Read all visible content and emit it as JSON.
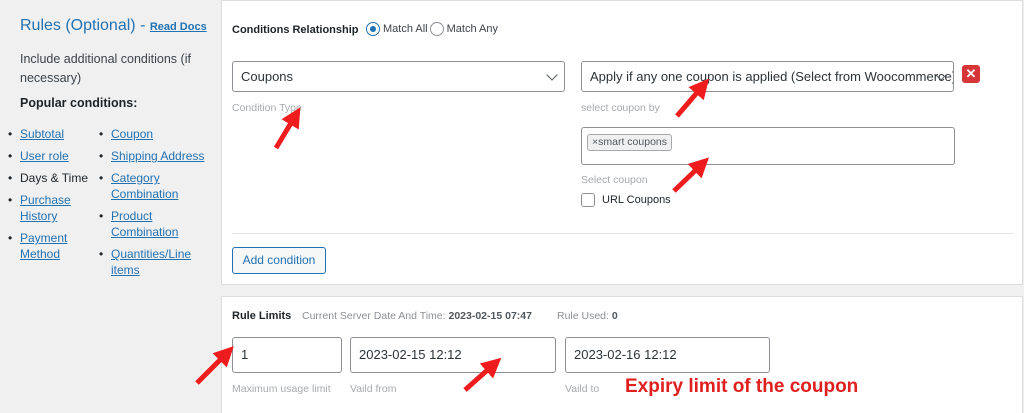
{
  "sidebar": {
    "title": "Rules (Optional)",
    "dash": "-",
    "read_docs": "Read Docs",
    "description": "Include additional conditions (if necessary)",
    "popular_label": "Popular conditions:",
    "col1": [
      {
        "label": "Subtotal",
        "link": true
      },
      {
        "label": "User role",
        "link": true
      },
      {
        "label": "Days & Time",
        "link": false
      },
      {
        "label": "Purchase History",
        "link": true
      },
      {
        "label": "Payment Method",
        "link": true
      }
    ],
    "col2": [
      {
        "label": "Coupon",
        "link": true
      },
      {
        "label": "Shipping Address",
        "link": true
      },
      {
        "label": "Category Combination",
        "link": true
      },
      {
        "label": "Product Combination",
        "link": true
      },
      {
        "label": "Quantities/Line items",
        "link": true
      }
    ]
  },
  "conditions": {
    "relationship_label": "Conditions Relationship",
    "match_all": "Match All",
    "match_any": "Match Any",
    "selected": "Match All",
    "condition_type_value": "Coupons",
    "condition_type_hint": "Condition Type",
    "coupon_rule_value": "Apply if any one coupon is applied (Select from Woocommerce)",
    "coupon_rule_hint": "select coupon by",
    "selected_coupon_tag": "smart coupons",
    "tag_remove": "×",
    "select_coupon_hint": "Select coupon",
    "url_coupons_label": "URL Coupons",
    "url_coupons_checked": false,
    "delete_label": "✕",
    "add_condition": "Add condition"
  },
  "rule_limits": {
    "label": "Rule Limits",
    "server_time_label": "Current Server Date And Time:",
    "server_time_value": "2023-02-15 07:47",
    "rule_used_label": "Rule Used:",
    "rule_used_value": "0",
    "max_usage_value": "1",
    "max_usage_hint": "Maximum usage limit",
    "valid_from_value": "2023-02-15 12:12",
    "valid_from_hint": "Vaild from",
    "valid_to_value": "2023-02-16 12:12",
    "valid_to_hint": "Vaild to"
  },
  "annotation": {
    "expiry_text": "Expiry limit of the coupon",
    "color": "#e0201e"
  },
  "colors": {
    "accent": "#2271b1",
    "danger": "#d63638"
  }
}
